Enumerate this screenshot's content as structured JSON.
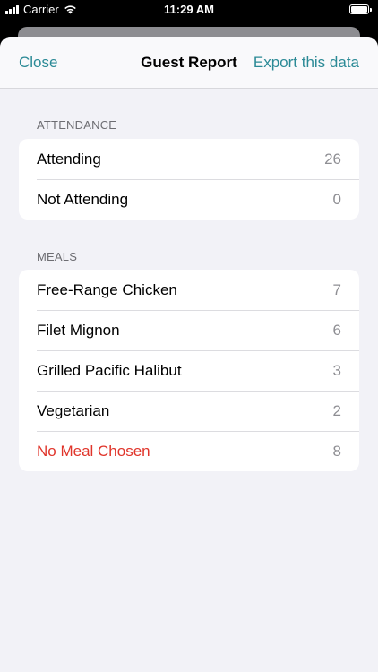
{
  "status_bar": {
    "carrier": "Carrier",
    "time": "11:29 AM",
    "icons": [
      "signal-icon",
      "wifi-icon",
      "battery-icon"
    ]
  },
  "nav": {
    "close_label": "Close",
    "title": "Guest Report",
    "export_label": "Export this data"
  },
  "colors": {
    "accent": "#2b8a96",
    "alert": "#e0352b",
    "secondary_text": "#8e8e93",
    "background": "#f2f2f7"
  },
  "attendance": {
    "header": "ATTENDANCE",
    "rows": [
      {
        "label": "Attending",
        "value": "26"
      },
      {
        "label": "Not Attending",
        "value": "0"
      }
    ]
  },
  "meals": {
    "header": "MEALS",
    "rows": [
      {
        "label": "Free-Range Chicken",
        "value": "7"
      },
      {
        "label": "Filet Mignon",
        "value": "6"
      },
      {
        "label": "Grilled Pacific Halibut",
        "value": "3"
      },
      {
        "label": "Vegetarian",
        "value": "2"
      },
      {
        "label": "No Meal Chosen",
        "value": "8"
      }
    ]
  }
}
